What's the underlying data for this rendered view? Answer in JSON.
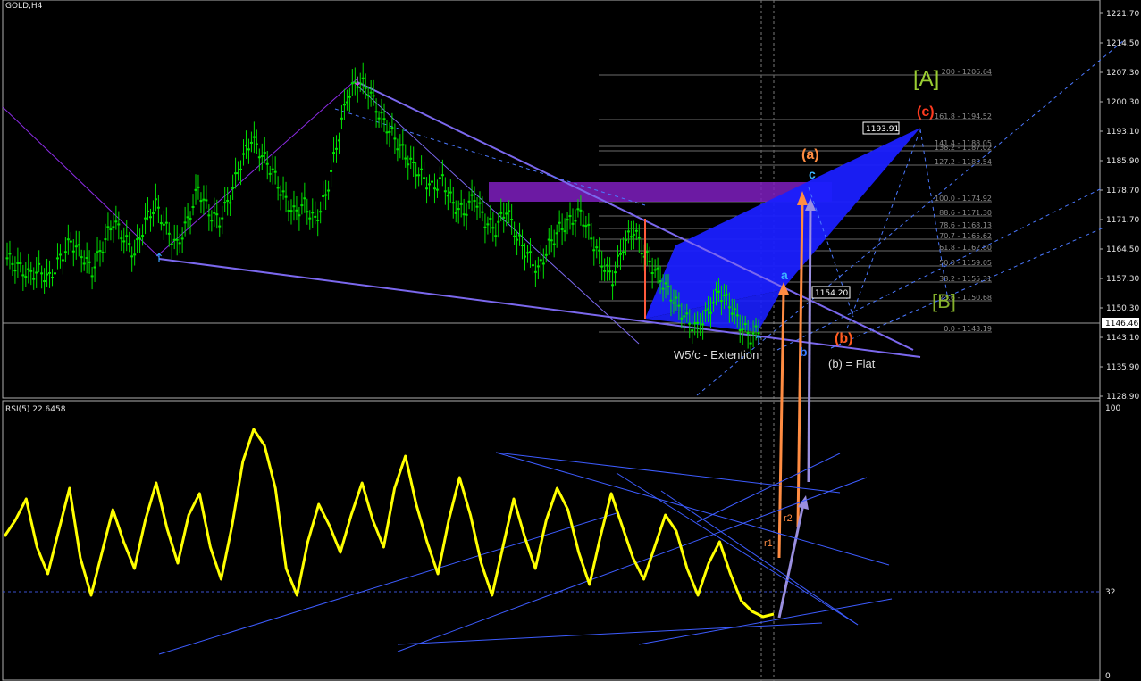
{
  "window": {
    "title": "GOLD,H4"
  },
  "rsi_panel": {
    "title": "RSI(5) 22.6458",
    "levels": [
      "100",
      "32",
      "0"
    ]
  },
  "price_axis": {
    "ticks": [
      "1221.70",
      "1214.50",
      "1207.30",
      "1200.30",
      "1193.10",
      "1185.90",
      "1178.70",
      "1171.70",
      "1164.50",
      "1157.30",
      "1150.30",
      "1143.10",
      "1135.90",
      "1128.90"
    ],
    "current_price": "1146.46"
  },
  "price_tags": {
    "tag1": "1193.91",
    "tag2": "1154.20"
  },
  "fibonacci": {
    "levels": [
      {
        "label": "200 - 1206.64"
      },
      {
        "label": "161.8 - 1194.52"
      },
      {
        "label": "141.4 - 1188.05"
      },
      {
        "label": "138.2 - 1187.02"
      },
      {
        "label": "127.2 - 1183.54"
      },
      {
        "label": "100.0 - 1174.92"
      },
      {
        "label": "88.6 - 1171.30"
      },
      {
        "label": "78.6 - 1168.13"
      },
      {
        "label": "70.7 - 1165.62"
      },
      {
        "label": "61.8 - 1162.80"
      },
      {
        "label": "50.0 - 1159.05"
      },
      {
        "label": "38.2 - 1155.31"
      },
      {
        "label": "23.6 - 1150.68"
      },
      {
        "label": "0.0 - 1143.19"
      }
    ]
  },
  "annotations": {
    "wave_A": "[A]",
    "wave_c": "(c)",
    "wave_a": "(a)",
    "wave_b": "(b)",
    "wave_B": "[B]",
    "point_a": "a",
    "point_b": "b",
    "point_c": "c",
    "w5_extention": "W5/c - Extention",
    "b_flat": "(b) = Flat",
    "r1": "r1",
    "r2": "r2"
  },
  "colors": {
    "background": "#000000",
    "candle": "#00e000",
    "rsi_line": "#ffff00",
    "trend_line": "#7b68ee",
    "pattern_fill": "#1a20ff",
    "zone_fill": "#7f1fbf",
    "arrow_orange": "#ff8c42",
    "arrow_purple": "#9a8fe0"
  },
  "chart_data": {
    "type": "line",
    "title": "GOLD,H4",
    "ylim": [
      1126.0,
      1225.0
    ],
    "series": [
      {
        "values": [
          1163,
          1161,
          1159,
          1160,
          1158,
          1163,
          1167,
          1164,
          1160,
          1166,
          1172,
          1168,
          1164,
          1172,
          1176,
          1170,
          1166,
          1172,
          1180,
          1174,
          1172,
          1178,
          1186,
          1192,
          1188,
          1184,
          1178,
          1174,
          1176,
          1172,
          1178,
          1190,
          1202,
          1206,
          1204,
          1198,
          1194,
          1190,
          1186,
          1183,
          1180,
          1182,
          1176,
          1174,
          1178,
          1172,
          1170,
          1175,
          1168,
          1164,
          1160,
          1166,
          1170,
          1172,
          1174,
          1168,
          1162,
          1158,
          1166,
          1170,
          1164,
          1160,
          1156,
          1152,
          1148,
          1146,
          1150,
          1155,
          1152,
          1147,
          1144,
          1146
        ]
      },
      {
        "values": [
          52,
          58,
          66,
          48,
          38,
          54,
          70,
          44,
          30,
          46,
          62,
          50,
          40,
          58,
          72,
          55,
          42,
          60,
          68,
          48,
          36,
          56,
          80,
          92,
          86,
          70,
          40,
          30,
          50,
          64,
          56,
          46,
          60,
          72,
          58,
          48,
          70,
          82,
          64,
          50,
          38,
          58,
          74,
          60,
          42,
          30,
          48,
          66,
          52,
          40,
          58,
          70,
          62,
          46,
          34,
          52,
          68,
          56,
          44,
          36,
          48,
          60,
          54,
          40,
          30,
          42,
          50,
          38,
          28,
          24,
          22,
          23
        ]
      }
    ]
  }
}
